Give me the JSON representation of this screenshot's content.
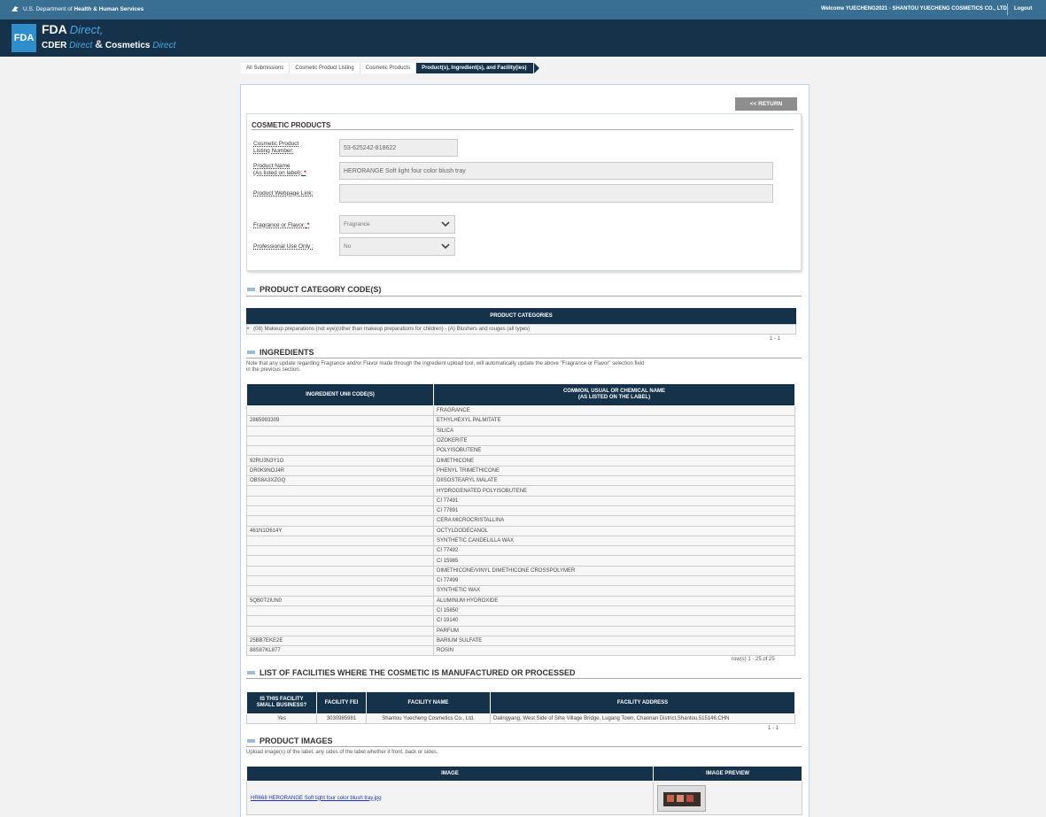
{
  "topbar": {
    "agency_prefix": "U.S. Department of ",
    "agency_bold": "Health & Human Services",
    "welcome": "Welcome YUECHENG2021 - SHANTOU YUECHENG COSMETICS CO., LTD.",
    "logout": "Logout"
  },
  "header": {
    "fda_logo": "FDA",
    "brand_main": "FDA",
    "brand_direct": "Direct,",
    "brand_cder": "CDER",
    "brand_cder_direct": "Direct",
    "brand_amp": "&",
    "brand_cosmetics": "Cosmetics",
    "brand_cosmetics_direct": "Direct"
  },
  "breadcrumb": {
    "items": [
      "All Submissions",
      "Cosmetic Product Listing",
      "Cosmetic Products",
      "Product(s), Ingredient(s), and Facility(ies)"
    ]
  },
  "return_label": "<< RETURN",
  "cosmetic_products": {
    "title": "COSMETIC PRODUCTS",
    "listing_label_1": "Cosmetic Product",
    "listing_label_2": "Listing Number:",
    "listing_value": "53-625242-818622",
    "name_label_1": "Product Name",
    "name_label_2": "(As listed on label):",
    "name_value": "HERORANGE Soft light four color blush tray",
    "webpage_label": "Product Webpage Link:",
    "webpage_value": "",
    "fragrance_label": "Fragrance or Flavor:",
    "fragrance_value": "Fragrance",
    "professional_label": "Professional Use Only :",
    "professional_value": "No",
    "required_mark": "*"
  },
  "category": {
    "title": "PRODUCT CATEGORY CODE(S)",
    "header": "PRODUCT CATEGORIES",
    "bullet": "•",
    "item": "(08) Makeup preparations (not eye)(other than makeup preparations for children) - (A) Blushers and rouges (all types)",
    "pager": "1 - 1"
  },
  "ingredients": {
    "title": "INGREDIENTS",
    "note_1": "Note that any update regarding Fragrance and/or Flavor made through the ingredient upload tool, will automatically update the above \"Fragrance or Flavor\" selection field",
    "note_2": "in the previous section.",
    "col1": "INGREDIENT UNII CODE(S)",
    "col2_1": "COMMON, USUAL OR CHEMICAL NAME",
    "col2_2": "(AS LISTED ON THE LABEL)",
    "rows": [
      [
        "",
        "FRAGRANCE"
      ],
      [
        "2865993309",
        "ETHYLHEXYL PALMITATE"
      ],
      [
        "",
        "SILICA"
      ],
      [
        "",
        "OZOKERITE"
      ],
      [
        "",
        "POLYISOBUTENE"
      ],
      [
        "92RU3N3Y1O",
        "DIMETHICONE"
      ],
      [
        "DR0K9NOJ4R",
        "PHENYL TRIMETHICONE"
      ],
      [
        "OBS8A3XZGQ",
        "DIISOSTEARYL MALATE"
      ],
      [
        "",
        "HYDROGENATED POLYISOBUTENE"
      ],
      [
        "",
        "CI 77491"
      ],
      [
        "",
        "CI 77891"
      ],
      [
        "",
        "CERA MICROCRISTALLINA"
      ],
      [
        "461N1O614Y",
        "OCTYLDODECANOL"
      ],
      [
        "",
        "SYNTHETIC CANDELILLA WAX"
      ],
      [
        "",
        "CI 77492"
      ],
      [
        "",
        "CI 15985"
      ],
      [
        "",
        "DIMETHICONE/VINYL DIMETHICONE CROSSPOLYMER"
      ],
      [
        "",
        "CI 77499"
      ],
      [
        "",
        "SYNTHETIC WAX"
      ],
      [
        "5QB0T2IUN0",
        "ALUMINUM HYDROXIDE"
      ],
      [
        "",
        "CI 15850"
      ],
      [
        "",
        "CI 19140"
      ],
      [
        "",
        "PARFUM"
      ],
      [
        "25BB7EKE2E",
        "BARIUM SULFATE"
      ],
      [
        "88S87KL877",
        "ROSIN"
      ]
    ],
    "pager": "row(s) 1 - 25 of 25"
  },
  "facilities": {
    "title": "LIST OF FACILITIES WHERE THE COSMETIC IS MANUFACTURED OR PROCESSED",
    "col1_1": "IS THIS FACILITY",
    "col1_2": "SMALL BUSINESS?",
    "col2": "FACILITY FEI",
    "col3": "FACILITY NAME",
    "col4": "FACILITY ADDRESS",
    "row": {
      "small": "Yes",
      "fei": "3030985981",
      "name": "Shantou Yuecheng Cosmetics Co., Ltd.",
      "address": "Dalingyang, West Side of Sihe Village Bridge, Lugang Town, Chaonan District,Shantou,515146,CHN"
    },
    "pager": "1 - 1"
  },
  "images": {
    "title": "PRODUCT IMAGES",
    "note": "Upload image(s) of the label, any sides of the label whether it front, back or sides.",
    "col1": "IMAGE",
    "col2": "IMAGE PREVIEW",
    "file": "HR668 HERORANGE Soft light four color blush tray.jpg"
  },
  "colors": {
    "topbar": "#3a6f94",
    "header": "#15324a",
    "accent": "#2f8dcc",
    "table_head": "#15324a",
    "required": "#cc0000"
  }
}
